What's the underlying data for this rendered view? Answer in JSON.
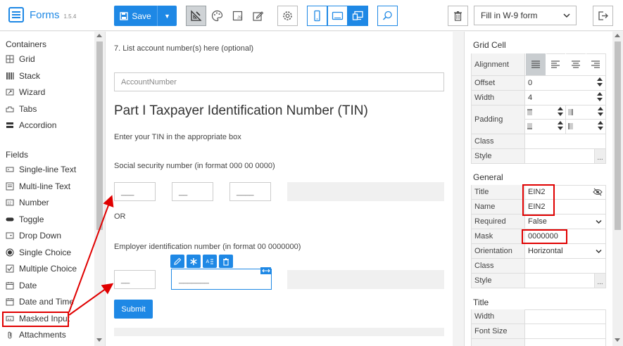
{
  "app": {
    "title": "Forms",
    "version": "1.5.4"
  },
  "toolbar": {
    "save_label": "Save",
    "form_select_value": "Fill in W-9 form"
  },
  "left": {
    "containers_title": "Containers",
    "containers": [
      "Grid",
      "Stack",
      "Wizard",
      "Tabs",
      "Accordion"
    ],
    "fields_title": "Fields",
    "fields": [
      "Single-line Text",
      "Multi-line Text",
      "Number",
      "Toggle",
      "Drop Down",
      "Single Choice",
      "Multiple Choice",
      "Date",
      "Date and Time",
      "Masked Input",
      "Attachments"
    ]
  },
  "canvas": {
    "account_label": "7. List account number(s) here (optional)",
    "account_placeholder": "AccountNumber",
    "heading": "Part I Taxpayer Identification Number (TIN)",
    "instruction": "Enter your TIN in the appropriate box",
    "ssn_label": "Social security number (in format 000 00 0000)",
    "ssn_parts": [
      "___",
      "__",
      "____"
    ],
    "or_text": "OR",
    "ein_label": "Employer identification number (in format 00 0000000)",
    "ein_parts": [
      "__",
      "_______"
    ],
    "submit_label": "Submit"
  },
  "props": {
    "grid_cell_title": "Grid Cell",
    "alignment_label": "Alignment",
    "offset_label": "Offset",
    "offset_value": "0",
    "width_label": "Width",
    "width_value": "4",
    "padding_label": "Padding",
    "class_label": "Class",
    "style_label": "Style",
    "dots": "...",
    "general_title": "General",
    "title_label": "Title",
    "title_value": "EIN2",
    "name_label": "Name",
    "name_value": "EIN2",
    "required_label": "Required",
    "required_value": "False",
    "mask_label": "Mask",
    "mask_value": "0000000",
    "orientation_label": "Orientation",
    "orientation_value": "Horizontal",
    "title_section": "Title",
    "t_width_label": "Width",
    "font_size_label": "Font Size"
  },
  "colors": {
    "accent": "#1e88e5",
    "annotation": "#e00000"
  }
}
